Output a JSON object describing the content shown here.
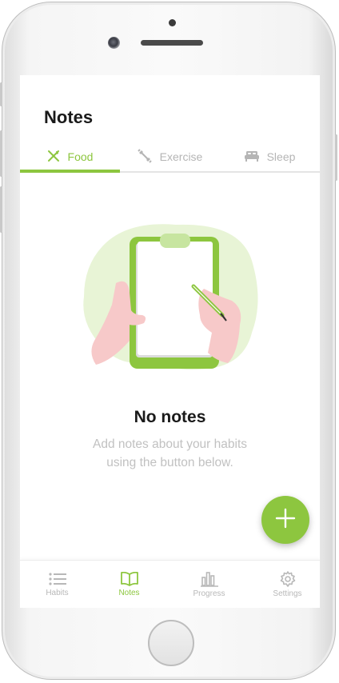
{
  "header": {
    "title": "Notes"
  },
  "tabs": [
    {
      "label": "Food",
      "icon": "fork-knife-icon",
      "active": true
    },
    {
      "label": "Exercise",
      "icon": "dumbbell-icon",
      "active": false
    },
    {
      "label": "Sleep",
      "icon": "bed-icon",
      "active": false
    }
  ],
  "empty_state": {
    "title": "No notes",
    "line1": "Add notes about your habits",
    "line2": "using the button below."
  },
  "fab": {
    "icon": "plus-icon"
  },
  "bottom_nav": [
    {
      "label": "Habits",
      "icon": "list-icon",
      "active": false
    },
    {
      "label": "Notes",
      "icon": "book-icon",
      "active": true
    },
    {
      "label": "Progress",
      "icon": "bar-chart-icon",
      "active": false
    },
    {
      "label": "Settings",
      "icon": "gear-icon",
      "active": false
    }
  ],
  "colors": {
    "accent": "#8dc63f",
    "inactive": "#b5b5b5",
    "text": "#1a1a1a",
    "subtext": "#c1c1c1"
  }
}
